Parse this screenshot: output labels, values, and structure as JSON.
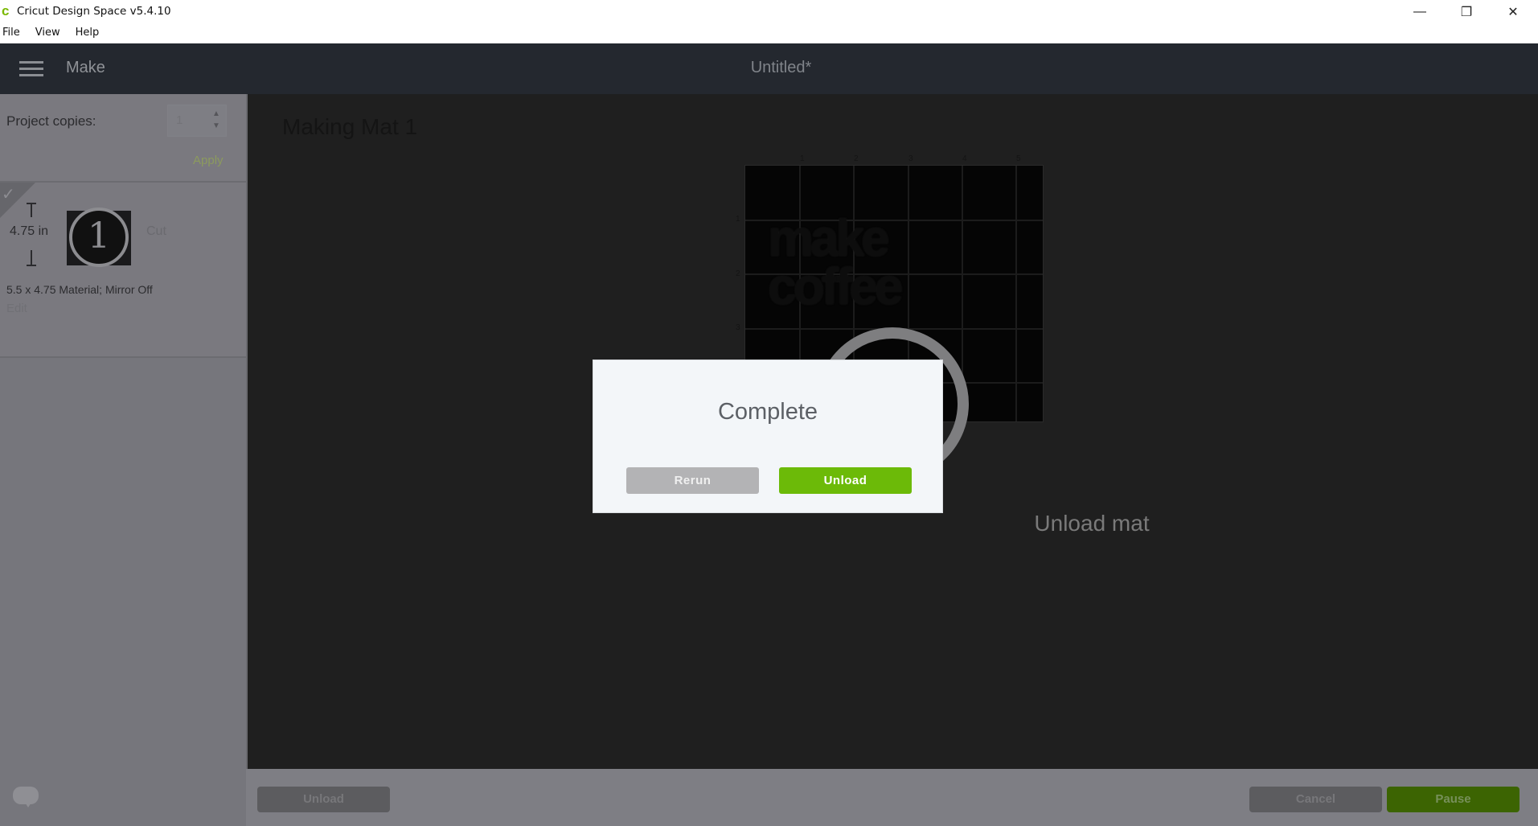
{
  "window": {
    "app_title": "Cricut Design Space  v5.4.10",
    "logo_icon": "cricut-c-logo",
    "controls": {
      "minimize": "—",
      "restore": "❐",
      "close": "✕"
    }
  },
  "menubar": {
    "items": [
      "File",
      "View",
      "Help"
    ]
  },
  "header": {
    "mode": "Make",
    "document_title": "Untitled*"
  },
  "sidebar": {
    "project_copies_label": "Project copies:",
    "project_copies_value": "1",
    "apply_label": "Apply",
    "mat_card": {
      "height_label": "4.75 in",
      "mat_number": "1",
      "operation": "Cut",
      "description": "5.5 x 4.75 Material; Mirror Off",
      "edit_label": "Edit",
      "completed": true
    }
  },
  "canvas": {
    "heading": "Making Mat 1",
    "mat": {
      "x_ticks": [
        "1",
        "2",
        "3",
        "4",
        "5"
      ],
      "y_ticks": [
        "1",
        "2",
        "3"
      ],
      "design_text_line1": "make",
      "design_text_line2": "coffee"
    },
    "status_text": "Unload mat"
  },
  "dialog": {
    "title": "Complete",
    "rerun_label": "Rerun",
    "unload_label": "Unload"
  },
  "footer": {
    "unload_label": "Unload",
    "cancel_label": "Cancel",
    "pause_label": "Pause"
  },
  "colors": {
    "accent_green": "#6cba08",
    "header_bg": "#24282f"
  }
}
